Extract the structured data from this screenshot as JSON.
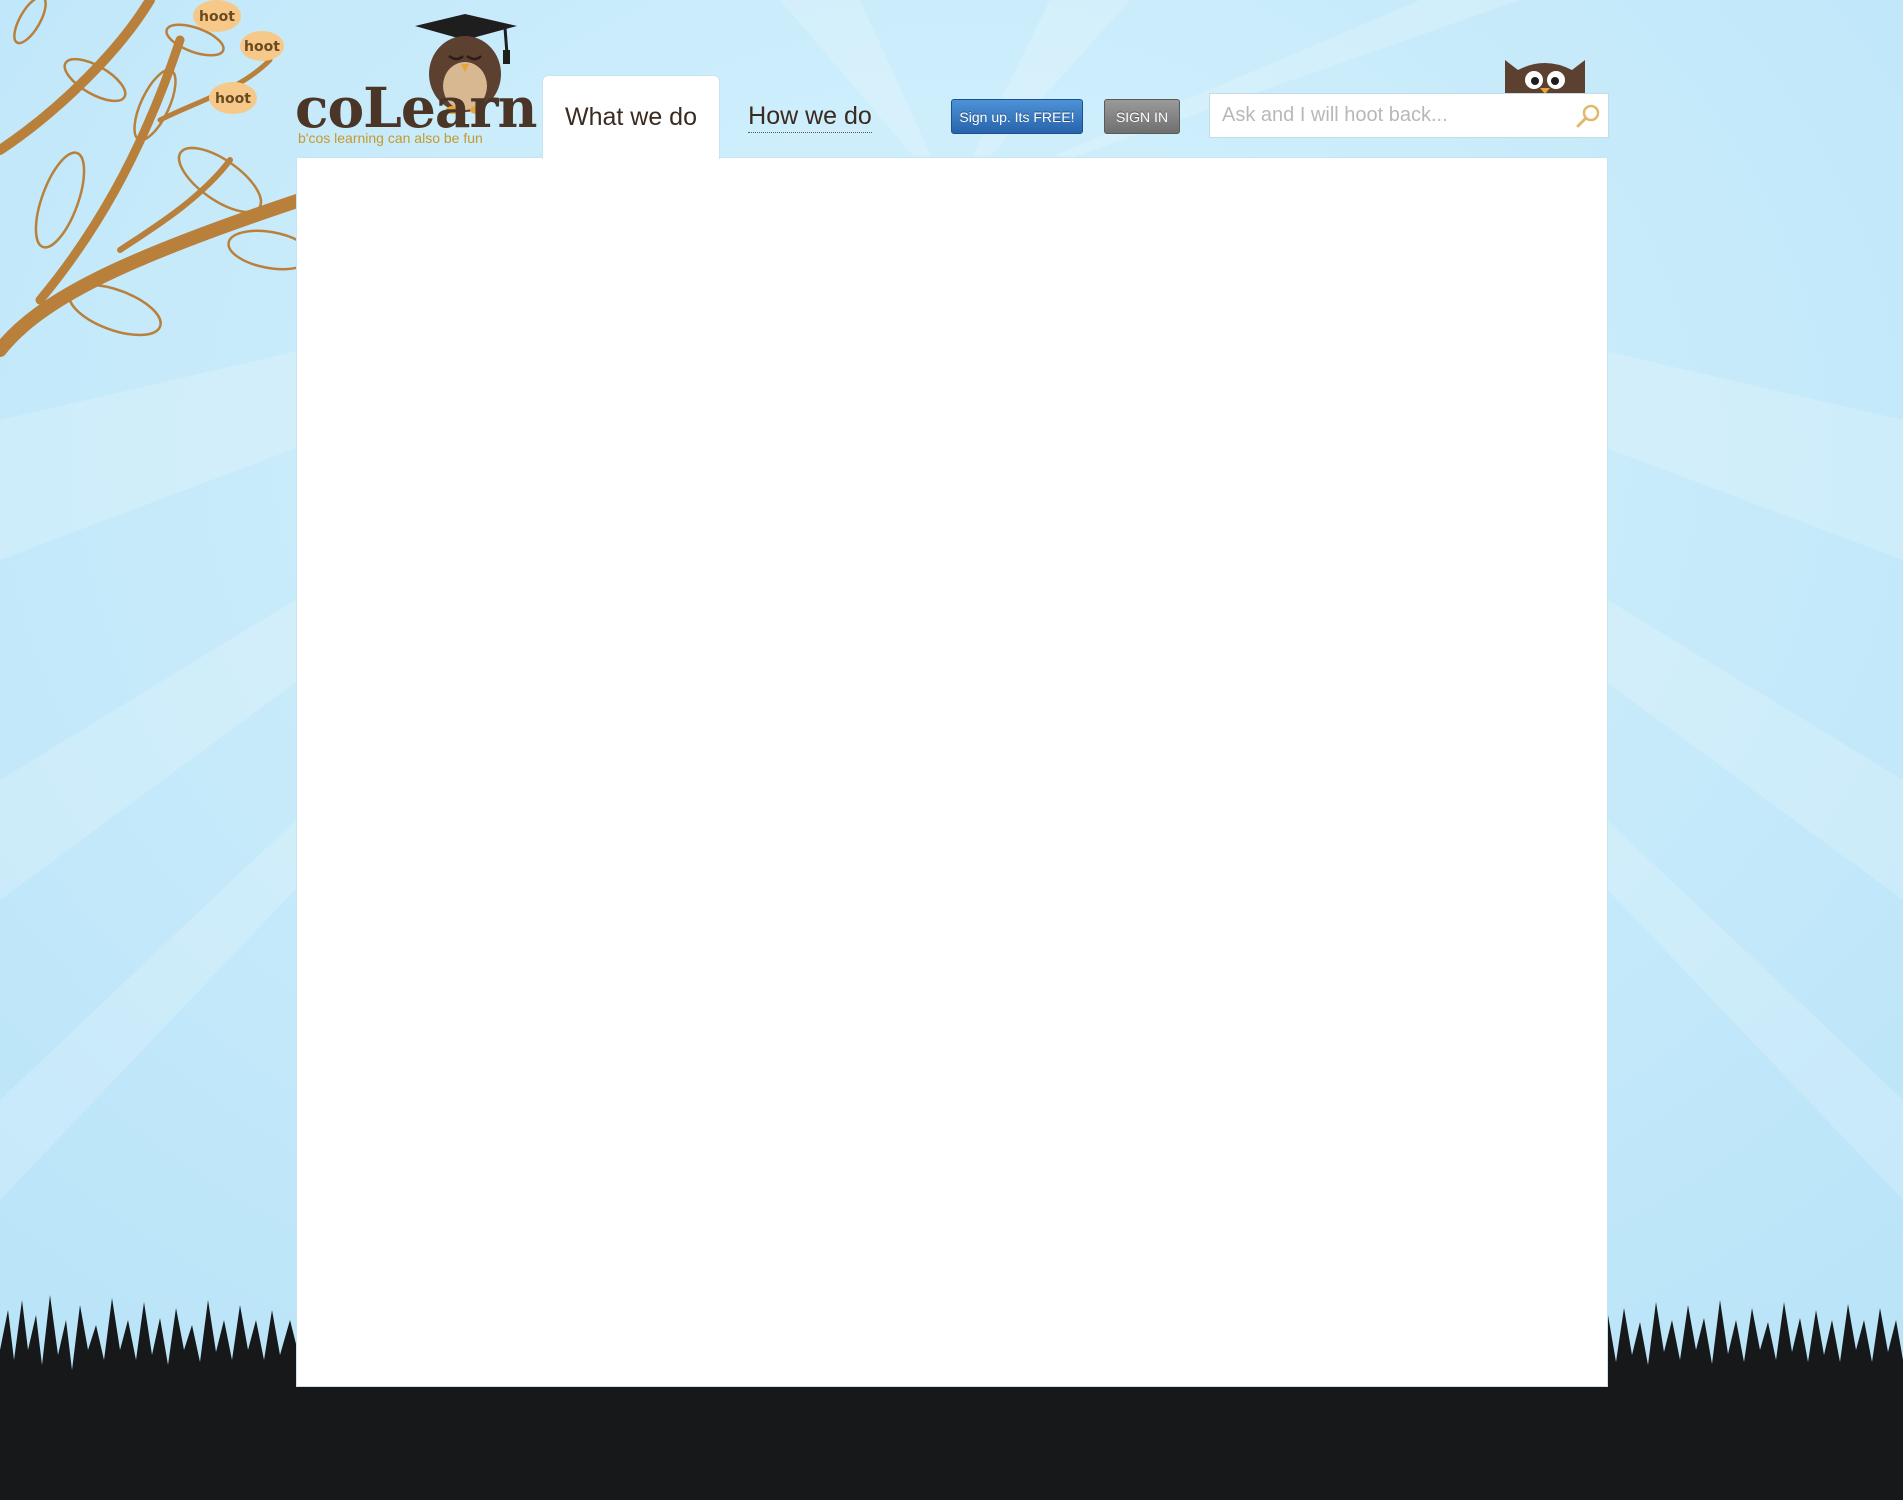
{
  "brand": {
    "name": "coLearn",
    "tagline": "b'cos learning can also be fun",
    "hoot_bubbles": [
      "hoot",
      "hoot",
      "hoot"
    ]
  },
  "nav": {
    "tabs": [
      {
        "label": "What we do",
        "active": true
      },
      {
        "label": "How we do",
        "active": false
      }
    ]
  },
  "actions": {
    "signup_label": "Sign up. Its FREE!",
    "signin_label": "SIGN IN"
  },
  "search": {
    "placeholder": "Ask and I will hoot back...",
    "value": ""
  },
  "colors": {
    "sky": "#cdeefc",
    "brand_brown": "#4a3526",
    "tagline_gold": "#c49a2c",
    "signup_blue": "#2f74c0",
    "signin_gray": "#7d7d7d",
    "ground": "#161819"
  }
}
